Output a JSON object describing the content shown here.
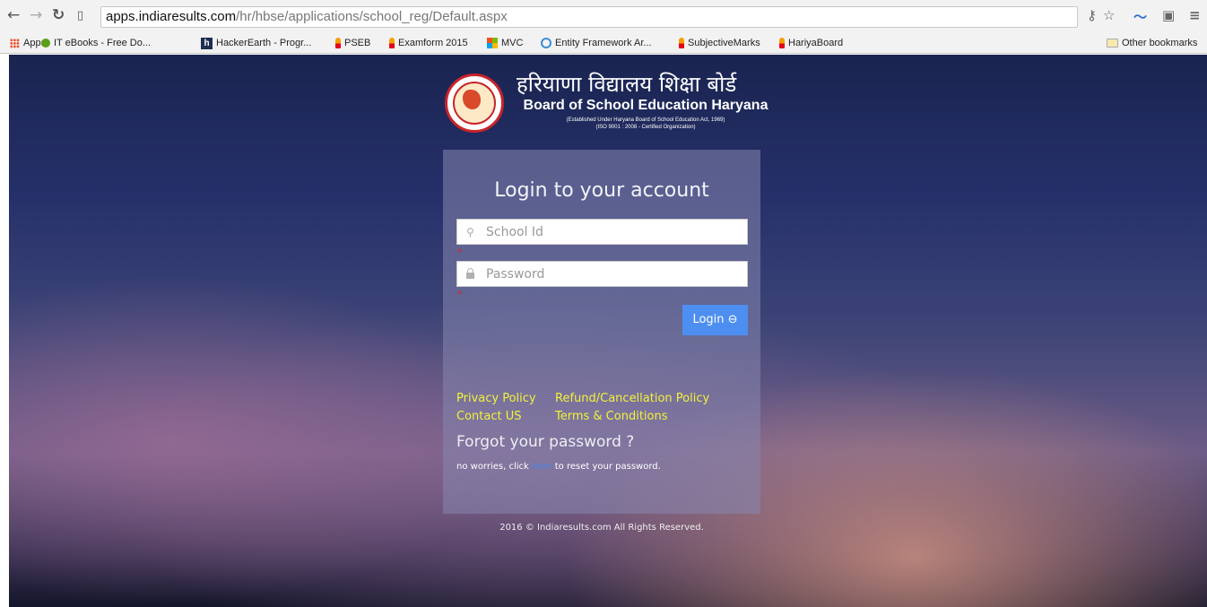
{
  "browser": {
    "url_host": "apps.indiaresults.com",
    "url_path": "/hr/hbse/applications/school_reg/Default.aspx"
  },
  "bookmarks": {
    "items": [
      {
        "label": "Apps",
        "icon": "apps-grid-icon"
      },
      {
        "label": "IT eBooks - Free Do...",
        "icon": "green-circle-icon"
      },
      {
        "label": "HackerEarth - Progr...",
        "icon": "hackerearth-icon"
      },
      {
        "label": "PSEB",
        "icon": "pin-icon"
      },
      {
        "label": "Examform 2015",
        "icon": "pin-icon"
      },
      {
        "label": "MVC",
        "icon": "windows-logo-icon"
      },
      {
        "label": "Entity Framework Ar...",
        "icon": "entity-framework-icon"
      },
      {
        "label": "SubjectiveMarks",
        "icon": "pin-icon"
      },
      {
        "label": "HariyaBoard",
        "icon": "pin-icon"
      }
    ],
    "other": "Other bookmarks"
  },
  "logo": {
    "hindi": "हरियाणा विद्यालय शिक्षा बोर्ड",
    "english": "Board of School Education Haryana",
    "line1": "(Established Under Haryana Board of School Education Act, 1969)",
    "line2": "(ISO 9001 : 2008 - Certified Organization)"
  },
  "login": {
    "title": "Login to your account",
    "school_id_placeholder": "School Id",
    "password_placeholder": "Password",
    "required_mark": "*",
    "button_label": "Login",
    "button_icon": "⊖"
  },
  "links": {
    "privacy": "Privacy Policy",
    "refund": "Refund/Cancellation Policy",
    "contact": "Contact US",
    "terms": "Terms & Conditions"
  },
  "forgot": {
    "heading": "Forgot your password ?",
    "prefix": "no worries, click",
    "link": "here",
    "suffix": "to reset your password."
  },
  "footer": "2016 © Indiaresults.com All Rights Reserved."
}
